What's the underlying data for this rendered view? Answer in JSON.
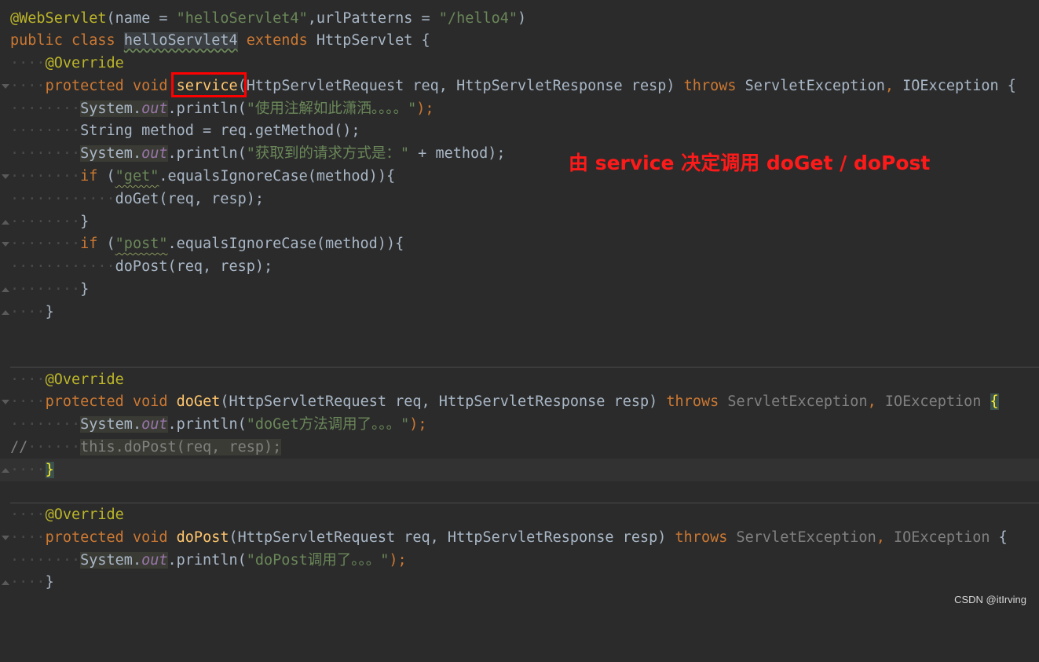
{
  "code": {
    "l1_ann": "@WebServlet",
    "l1_a": "(name = ",
    "l1_s1": "\"helloServlet4\"",
    "l1_b": ",urlPatterns = ",
    "l1_s2": "\"/hello4\"",
    "l1_c": ")",
    "l2_public": "public",
    "l2_class": "class",
    "l2_name": "helloServlet4",
    "l2_extends": "extends",
    "l2_base": "HttpServlet {",
    "override": "@Override",
    "protected": "protected",
    "void": "void",
    "service_name": "service",
    "service_params": "(HttpServletRequest req, HttpServletResponse resp) ",
    "throws": "throws",
    "exc1": "ServletException",
    "exc2": "IOException",
    "brace_open": " {",
    "system": "System",
    "dot": ".",
    "out": "out",
    "println": ".println(",
    "l5_str": "\"使用注解如此潇洒。。。。\"",
    "close_semi": ");",
    "l6": "String method = req.getMethod();",
    "l7_str": "\"获取到的请求方式是：\"",
    "l7_rest": " + method);",
    "if": "if",
    "str_get": "\"get\"",
    "str_post": "\"post\"",
    "equals": ".equalsIgnoreCase(method)){",
    "doget_call": "doGet(req, resp);",
    "dopost_call": "doPost(req, resp);",
    "close_brace": "}",
    "doget_name": "doGet",
    "dopost_name": "doPost",
    "method_params": "(HttpServletRequest req, HttpServletResponse resp) ",
    "doget_str": "\"doGet方法调用了。。。\"",
    "comment_prefix": "//",
    "comment_code": "this.doPost(req, resp);",
    "dopost_str": "\"doPost调用了。。。\""
  },
  "annotation_note": "由 service 决定调用 doGet / doPost",
  "watermark": "CSDN @itIrving",
  "colors": {
    "background": "#2b2b2b",
    "keyword": "#cc7832",
    "string": "#6a8759",
    "annotation": "#bbb529",
    "method": "#ffc66d",
    "field": "#9876aa",
    "highlight_box": "#ff0000",
    "note": "#ff1a1a"
  }
}
